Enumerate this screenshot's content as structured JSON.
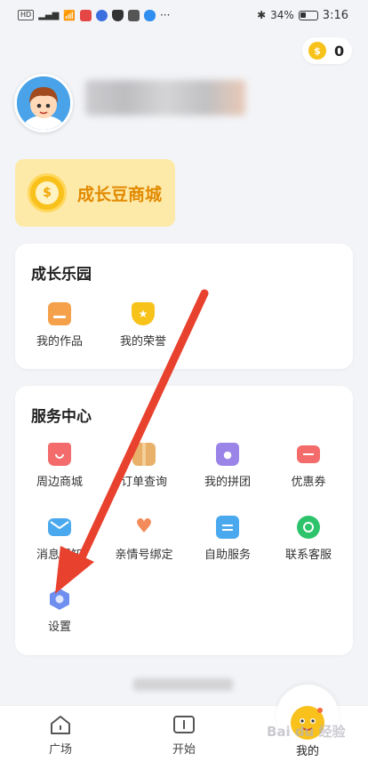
{
  "status_bar": {
    "network_badge": "HD",
    "signal": "4G",
    "battery_percent": "34%",
    "time": "3:16"
  },
  "coins": {
    "count": "0"
  },
  "mall": {
    "label": "成长豆商城"
  },
  "growth_park": {
    "title": "成长乐园",
    "items": [
      {
        "label": "我的作品",
        "icon": "folder-icon",
        "color": "#f5a04a"
      },
      {
        "label": "我的荣誉",
        "icon": "medal-icon",
        "color": "#f7c21a"
      }
    ]
  },
  "service_center": {
    "title": "服务中心",
    "items": [
      {
        "label": "周边商城",
        "icon": "shopping-bag-icon",
        "color": "#f36b6b"
      },
      {
        "label": "订单查询",
        "icon": "package-icon",
        "color": "#e9b06a"
      },
      {
        "label": "我的拼团",
        "icon": "group-bag-icon",
        "color": "#9b84e8"
      },
      {
        "label": "优惠券",
        "icon": "coupon-icon",
        "color": "#f36b6b"
      },
      {
        "label": "消息通知",
        "icon": "mail-icon",
        "color": "#4aa9ee"
      },
      {
        "label": "亲情号绑定",
        "icon": "hearts-icon",
        "color": "#f38a5a"
      },
      {
        "label": "自助服务",
        "icon": "clipboard-icon",
        "color": "#4aa9ee"
      },
      {
        "label": "联系客服",
        "icon": "chat-icon",
        "color": "#2cc36b"
      },
      {
        "label": "设置",
        "icon": "settings-icon",
        "color": "#6f8ff0"
      }
    ]
  },
  "tabs": [
    {
      "label": "广场",
      "icon": "home-icon"
    },
    {
      "label": "开始",
      "icon": "book-icon"
    },
    {
      "label": "我的",
      "icon": "mascot-icon"
    }
  ],
  "watermark": "Bai du 经验"
}
